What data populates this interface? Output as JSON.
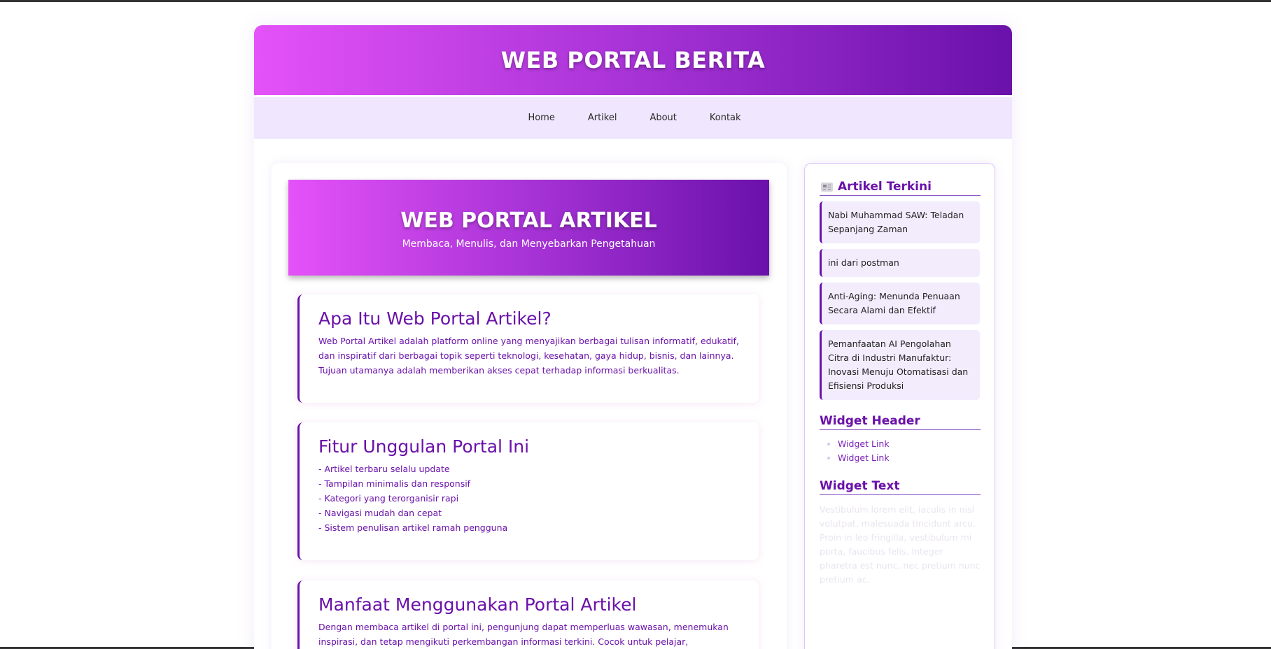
{
  "header": {
    "site_title": "WEB PORTAL BERITA"
  },
  "nav": {
    "items": [
      "Home",
      "Artikel",
      "About",
      "Kontak"
    ]
  },
  "hero": {
    "title": "WEB PORTAL ARTIKEL",
    "subtitle": "Membaca, Menulis, dan Menyebarkan Pengetahuan"
  },
  "cards": [
    {
      "title": "Apa Itu Web Portal Artikel?",
      "body": "Web Portal Artikel adalah platform online yang menyajikan berbagai tulisan informatif, edukatif, dan inspiratif dari berbagai topik seperti teknologi, kesehatan, gaya hidup, bisnis, dan lainnya. Tujuan utamanya adalah memberikan akses cepat terhadap informasi berkualitas."
    },
    {
      "title": "Fitur Unggulan Portal Ini",
      "lines": [
        "- Artikel terbaru selalu update",
        "- Tampilan minimalis dan responsif",
        "- Kategori yang terorganisir rapi",
        "- Navigasi mudah dan cepat",
        "- Sistem penulisan artikel ramah pengguna"
      ]
    },
    {
      "title": "Manfaat Menggunakan Portal Artikel",
      "body": "Dengan membaca artikel di portal ini, pengunjung dapat memperluas wawasan, menemukan inspirasi, dan tetap mengikuti perkembangan informasi terkini. Cocok untuk pelajar, profesional, hingga penulis"
    }
  ],
  "sidebar": {
    "recent_title": "Artikel Terkini",
    "recent_icon": "newspaper-icon",
    "articles": [
      "Nabi Muhammad SAW: Teladan Sepanjang Zaman",
      "ini dari postman",
      "Anti-Aging: Menunda Penuaan Secara Alami dan Efektif",
      "Pemanfaatan AI Pengolahan Citra di Industri Manufaktur: Inovasi Menuju Otomatisasi dan Efisiensi Produksi"
    ],
    "widget_header_title": "Widget Header",
    "widget_links": [
      "Widget Link",
      "Widget Link"
    ],
    "widget_text_title": "Widget Text",
    "widget_text": "Vestibulum lorem elit, iaculis in nisl volutpat, malesuada tincidunt arcu. Proin in leo fringilla, vestibulum mi porta, faucibus felis. Integer pharetra est nunc, nec pretium nunc pretium ac."
  },
  "colors": {
    "gradient_start": "#e452f8",
    "gradient_end": "#6a11aa",
    "accent": "#6a11aa",
    "nav_bg": "#f0e6fe"
  }
}
